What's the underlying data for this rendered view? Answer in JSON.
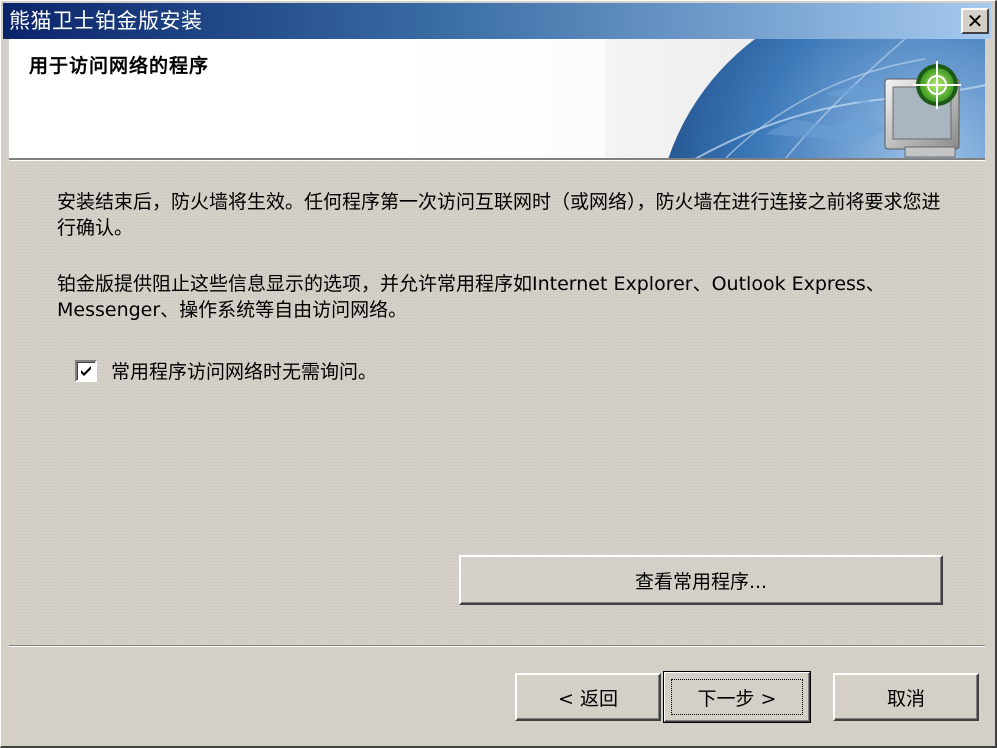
{
  "window": {
    "title": "熊猫卫士铂金版安装",
    "close_symbol": "✕"
  },
  "header": {
    "title": "用于访问网络的程序",
    "banner_icon": "globe-monitor-target-icon"
  },
  "content": {
    "paragraph1": "安装结束后，防火墙将生效。任何程序第一次访问互联网时（或网络），防火墙在进行连接之前将要求您进行确认。",
    "paragraph2": "铂金版提供阻止这些信息显示的选项，并允许常用程序如Internet Explorer、Outlook Express、Messenger、操作系统等自由访问网络。",
    "checkbox": {
      "label": "常用程序访问网络时无需询问。",
      "checked": true
    },
    "view_button_label": "查看常用程序..."
  },
  "footer": {
    "back_label": "< 返回",
    "next_label": "下一步 >",
    "cancel_label": "取消"
  },
  "colors": {
    "title_bar_start": "#0a246a",
    "title_bar_end": "#a6caf0",
    "dialog_face": "#d4d0c8"
  }
}
